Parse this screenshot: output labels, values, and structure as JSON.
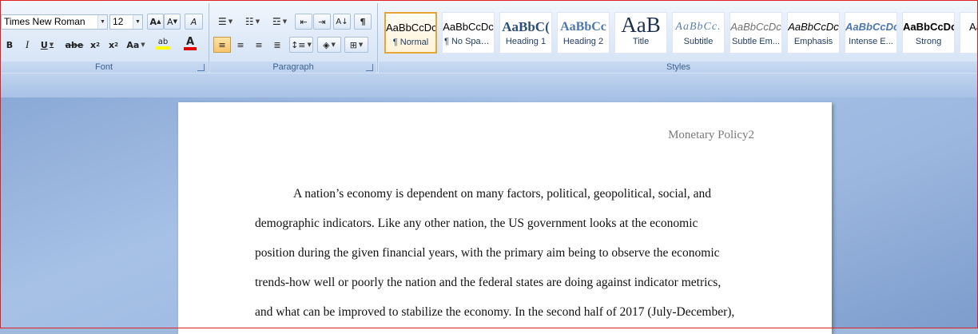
{
  "font_group": {
    "label": "Font",
    "font_name": "Times New Roman",
    "font_size": "12",
    "grow_label": "A",
    "shrink_label": "A",
    "clear_label": "A",
    "bold_label": "B",
    "italic_label": "I",
    "underline_label": "U",
    "strike_label": "abe",
    "subscript_label": "x",
    "superscript_label": "x",
    "case_label": "Aa",
    "highlight_label": "ab",
    "font_color_label": "A"
  },
  "paragraph_group": {
    "label": "Paragraph",
    "pilcrow_label": "¶"
  },
  "styles_group": {
    "label": "Styles",
    "items": [
      {
        "sample": "AaBbCcDc",
        "name": "¶ Normal",
        "selected": true
      },
      {
        "sample": "AaBbCcDc",
        "name": "¶ No Spaci..."
      },
      {
        "sample": "AaBbC(",
        "name": "Heading 1"
      },
      {
        "sample": "AaBbCc",
        "name": "Heading 2"
      },
      {
        "sample": "AaB",
        "name": "Title"
      },
      {
        "sample": "AaBbCc.",
        "name": "Subtitle"
      },
      {
        "sample": "AaBbCcDc",
        "name": "Subtle Em..."
      },
      {
        "sample": "AaBbCcDc",
        "name": "Emphasis"
      },
      {
        "sample": "AaBbCcDc",
        "name": "Intense E..."
      },
      {
        "sample": "AaBbCcDc",
        "name": "Strong"
      },
      {
        "sample": "Aa",
        "name": ""
      }
    ]
  },
  "document": {
    "header": "Monetary Policy2",
    "lines": [
      "A nation’s economy is dependent on many factors, political,  geopolitical,  social,  and",
      "demographic indicators. Like any other nation, the US government looks at the economic",
      "position during the given  financial  years, with the primary  aim being to observe the economic",
      "trends-how well or poorly the nation and the federal states are doing against indicator metrics,",
      "and what can be improved to stabilize  the economy.  In the second half of 2017 (July-December),"
    ]
  },
  "colors": {
    "accent_selected": "#e8a434",
    "ribbon_bg": "#dfeaf8",
    "workspace_bg": "#9fb9dd",
    "highlight_yellow": "#ffff00",
    "font_color_red": "#e00000"
  }
}
